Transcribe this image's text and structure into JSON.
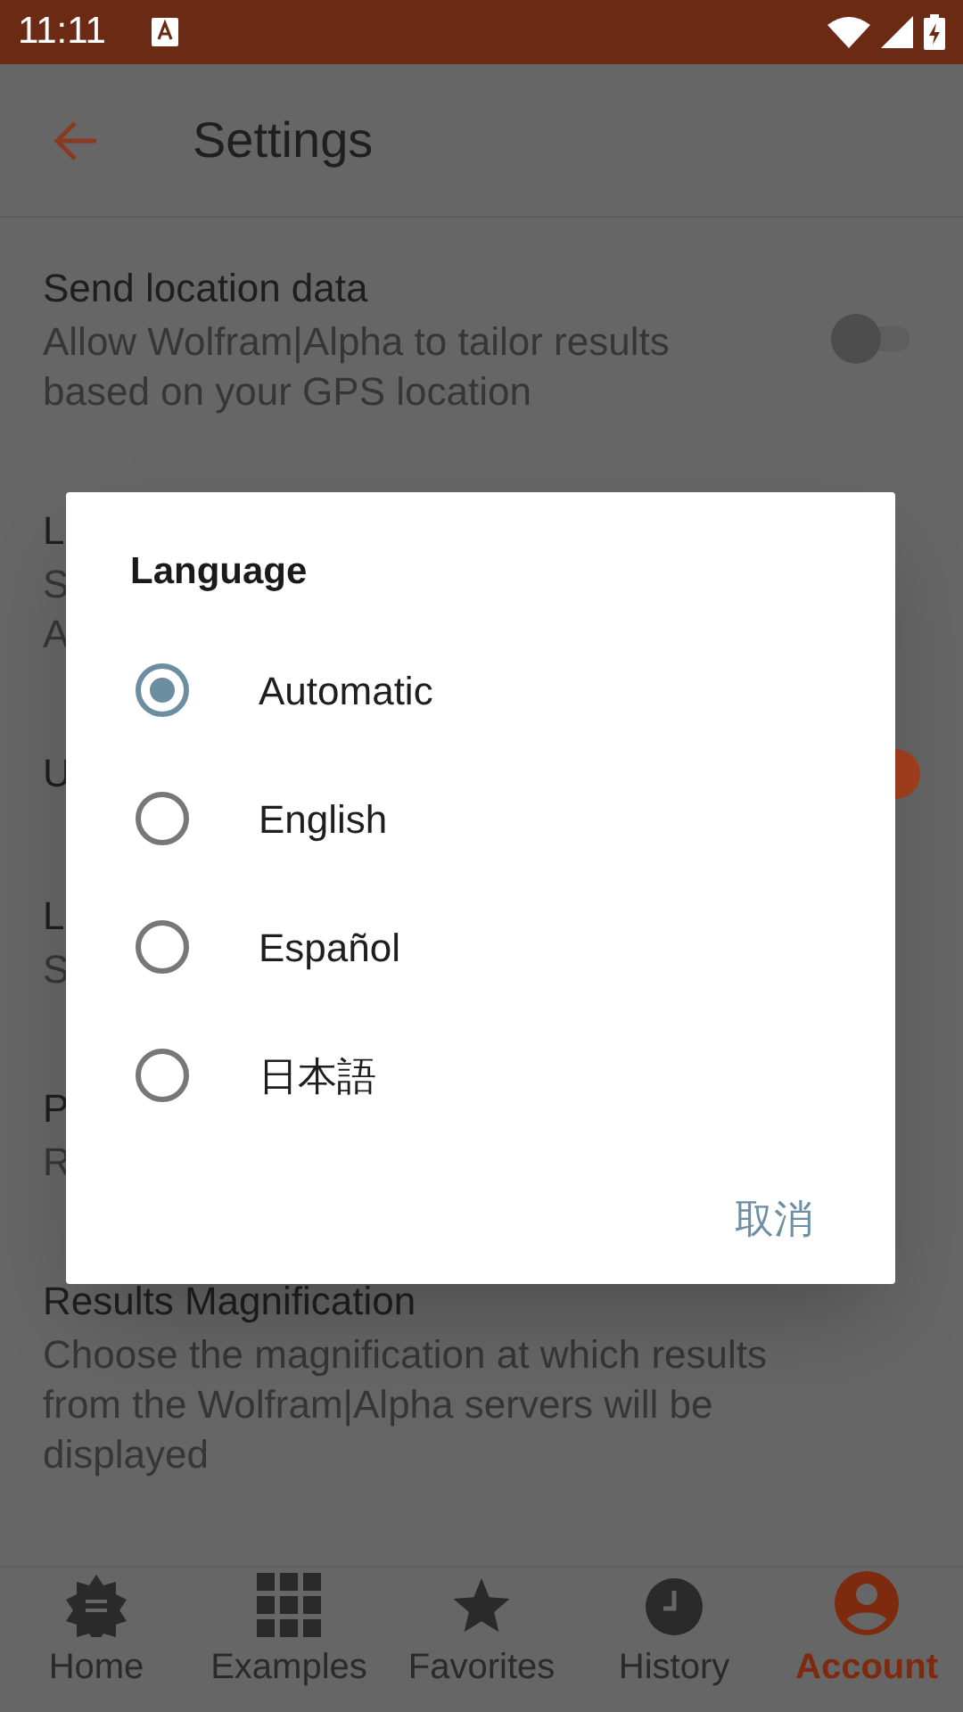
{
  "status_bar": {
    "time": "11:11"
  },
  "toolbar": {
    "title": "Settings"
  },
  "settings": [
    {
      "title": "Send location data",
      "description": [
        "Allow Wolfram|Alpha to tailor results",
        "based on your GPS location"
      ],
      "kind": "toggle",
      "on": false
    },
    {
      "title": "L",
      "description": [
        "S",
        "A"
      ],
      "kind": "plain"
    },
    {
      "title": "U",
      "kind": "toggle",
      "on": true
    },
    {
      "title": "L",
      "description": [
        "S"
      ],
      "kind": "plain"
    },
    {
      "title": "P",
      "description": [
        "R"
      ],
      "kind": "plain"
    },
    {
      "title": "Results Magnification",
      "description": [
        "Choose the magnification at which results",
        "from the Wolfram|Alpha servers will be",
        "displayed"
      ],
      "kind": "plain"
    }
  ],
  "dialog": {
    "title": "Language",
    "options": [
      {
        "label": "Automatic",
        "selected": true
      },
      {
        "label": "English",
        "selected": false
      },
      {
        "label": "Español",
        "selected": false
      },
      {
        "label": "日本語",
        "selected": false
      }
    ],
    "button": "取消"
  },
  "bottom_nav": [
    {
      "label": "Home",
      "kind": "home",
      "selected": false
    },
    {
      "label": "Examples",
      "kind": "examples",
      "selected": false
    },
    {
      "label": "Favorites",
      "kind": "favorites",
      "selected": false
    },
    {
      "label": "History",
      "kind": "history",
      "selected": false
    },
    {
      "label": "Account",
      "kind": "account",
      "selected": true
    }
  ]
}
